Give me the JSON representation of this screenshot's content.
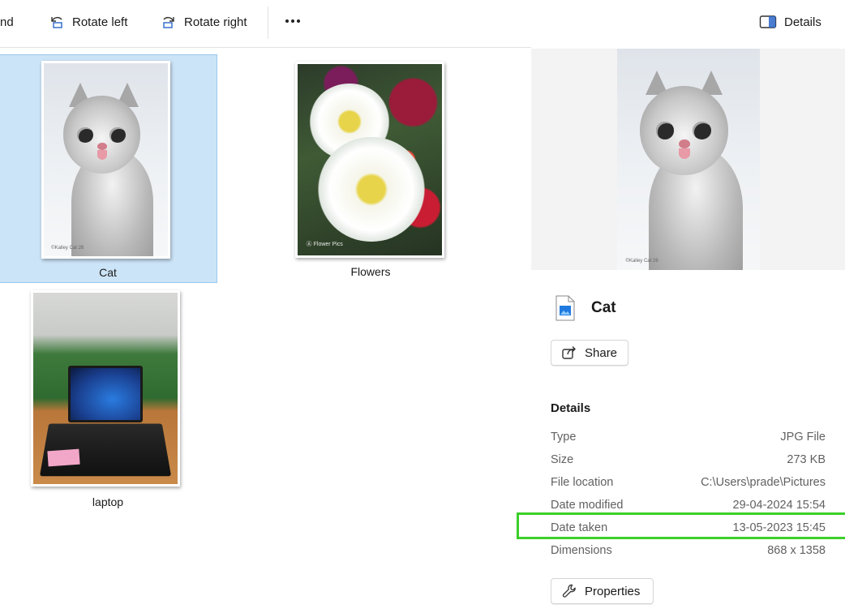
{
  "toolbar": {
    "partial_label": "nd",
    "rotate_left": "Rotate left",
    "rotate_right": "Rotate right",
    "details": "Details"
  },
  "files": [
    {
      "name": "Cat",
      "selected": true,
      "watermark": "©Kalley Cat 26"
    },
    {
      "name": "Flowers",
      "selected": false
    },
    {
      "name": "laptop",
      "selected": false
    }
  ],
  "details_pane": {
    "preview_watermark": "©Kalley Cat 26",
    "file_name": "Cat",
    "share_label": "Share",
    "section_title": "Details",
    "rows": [
      {
        "key": "Type",
        "value": "JPG File"
      },
      {
        "key": "Size",
        "value": "273 KB"
      },
      {
        "key": "File location",
        "value": "C:\\Users\\prade\\Pictures"
      },
      {
        "key": "Date modified",
        "value": "29-04-2024 15:54"
      },
      {
        "key": "Date taken",
        "value": "13-05-2023 15:45"
      },
      {
        "key": "Dimensions",
        "value": "868 x 1358"
      }
    ],
    "properties_label": "Properties"
  },
  "colors": {
    "selection_bg": "#cce4f7",
    "highlight_box": "#3ccf2a"
  }
}
